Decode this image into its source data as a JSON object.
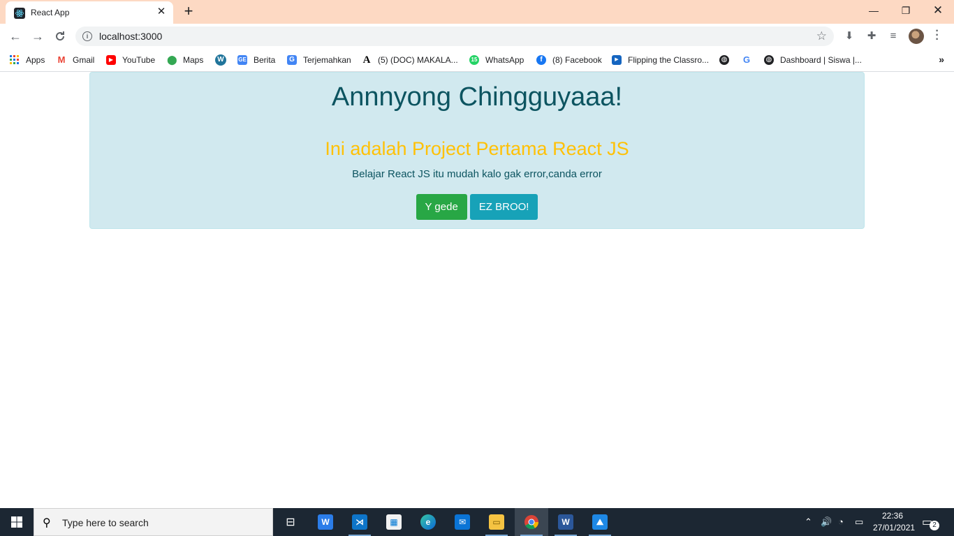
{
  "browser": {
    "tab": {
      "title": "React App",
      "favicon": "react-icon"
    },
    "window_controls": [
      "minimize-icon",
      "restore-icon",
      "close-icon"
    ],
    "address": {
      "url": "localhost:3000"
    },
    "bookmarks": [
      {
        "label": "Apps",
        "icon": "apps-grid-icon"
      },
      {
        "label": "Gmail",
        "icon": "gmail-icon",
        "color": "#ea4335"
      },
      {
        "label": "YouTube",
        "icon": "youtube-icon",
        "color": "#ff0000"
      },
      {
        "label": "Maps",
        "icon": "maps-icon",
        "color": "#34a853"
      },
      {
        "label": "",
        "icon": "wordpress-icon",
        "color": "#21759b"
      },
      {
        "label": "Berita",
        "icon": "google-news-icon",
        "color": "#4285f4"
      },
      {
        "label": "Terjemahkan",
        "icon": "google-translate-icon",
        "color": "#4285f4"
      },
      {
        "label": "(5) (DOC) MAKALA...",
        "icon": "academia-icon",
        "color": "#000000"
      },
      {
        "label": "WhatsApp",
        "icon": "whatsapp-icon",
        "color": "#25d366",
        "badge": "15"
      },
      {
        "label": "(8) Facebook",
        "icon": "facebook-icon",
        "color": "#1877f2"
      },
      {
        "label": "Flipping the Classro...",
        "icon": "video-icon",
        "color": "#1565c0"
      },
      {
        "label": "",
        "icon": "globe-icon",
        "color": "#202124"
      },
      {
        "label": "",
        "icon": "google-icon",
        "color": "#4285f4"
      },
      {
        "label": "Dashboard | Siswa |...",
        "icon": "globe-icon",
        "color": "#202124"
      }
    ]
  },
  "page": {
    "heading": "Annnyong Chingguyaaa!",
    "subheading": "Ini adalah Project Pertama React JS",
    "text": "Belajar React JS itu mudah kalo gak error,canda error",
    "buttons": {
      "primary": "Y gede",
      "secondary": "EZ BROO!"
    },
    "colors": {
      "panel": "#d1e9ef",
      "heading": "#0c5460",
      "subheading": "#ffc107",
      "success": "#28a745",
      "info": "#17a2b8"
    }
  },
  "taskbar": {
    "search_placeholder": "Type here to search",
    "time": "22:36",
    "date": "27/01/2021",
    "notification_count": "2"
  }
}
